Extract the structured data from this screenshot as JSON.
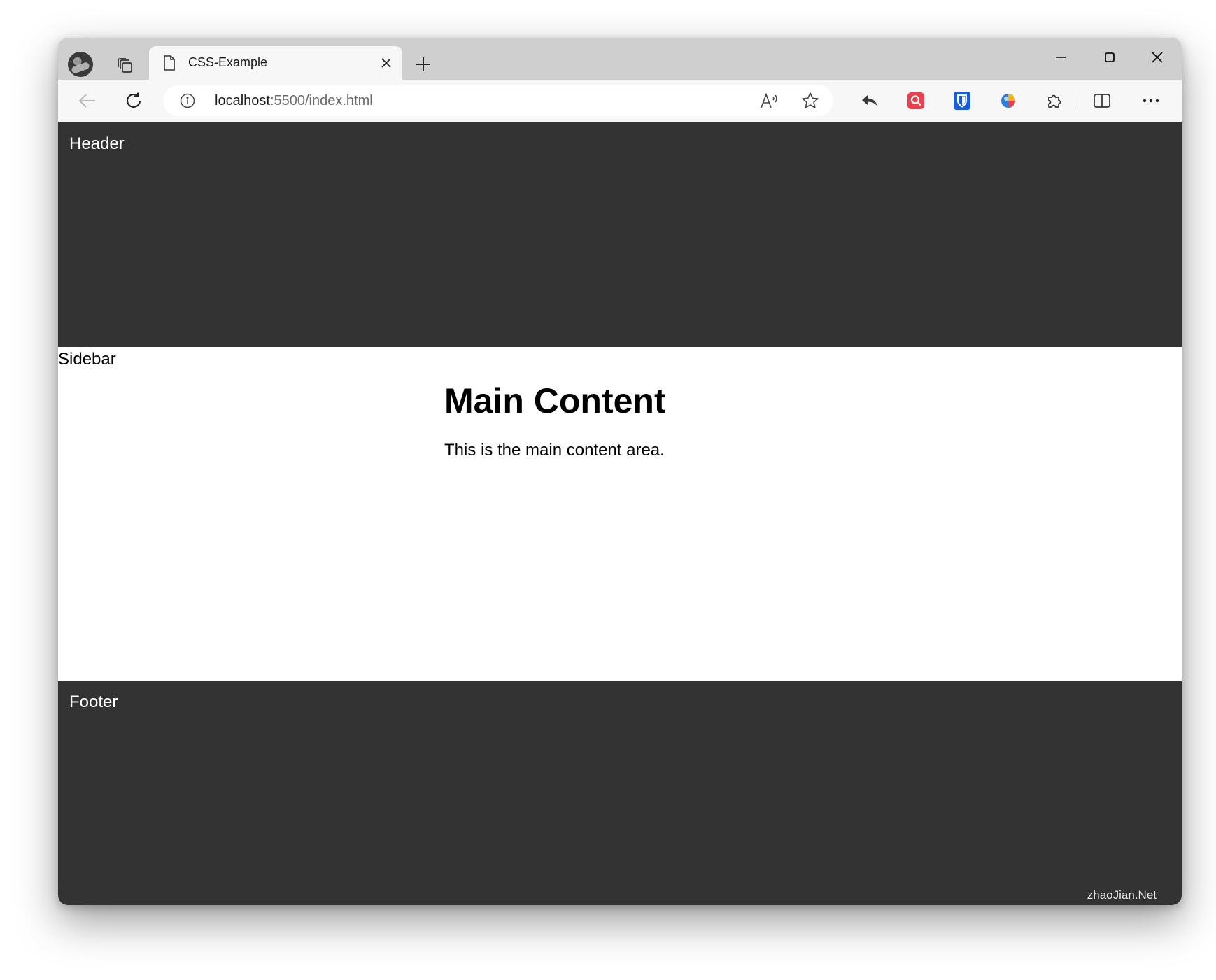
{
  "browser": {
    "tab": {
      "title": "CSS-Example"
    },
    "address_bar": {
      "url_host": "localhost",
      "url_rest": ":5500/index.html"
    },
    "icons": {
      "profile": "profile-avatar-icon",
      "collections": "collections-icon",
      "tab_page": "page-icon",
      "tab_close": "close-icon",
      "new_tab": "plus-icon",
      "minimize": "minimize-icon",
      "maximize": "maximize-icon",
      "window_close": "close-icon",
      "back": "arrow-left-icon",
      "reload": "reload-icon",
      "site_info": "info-icon",
      "read_aloud": "read-aloud-icon",
      "favorite": "star-icon",
      "reply_extension": "reply-arrow-icon",
      "search_extension": "search-extension-icon",
      "bitwarden_extension": "shield-icon",
      "ball_extension": "colorful-ball-icon",
      "extensions": "puzzle-icon",
      "split_screen": "split-screen-icon",
      "more": "more-icon"
    },
    "colors": {
      "tab_strip": "#cfcfcf",
      "toolbar": "#f7f7f7",
      "search_extension": "#e8414d",
      "bitwarden_extension": "#175ddc"
    }
  },
  "page": {
    "header_text": "Header",
    "sidebar_text": "Sidebar",
    "main": {
      "heading": "Main Content",
      "paragraph": "This is the main content area."
    },
    "footer_text": "Footer",
    "watermark": "zhaoJian.Net",
    "colors": {
      "header_bg": "#333333",
      "footer_bg": "#333333",
      "content_bg": "#ffffff"
    }
  }
}
